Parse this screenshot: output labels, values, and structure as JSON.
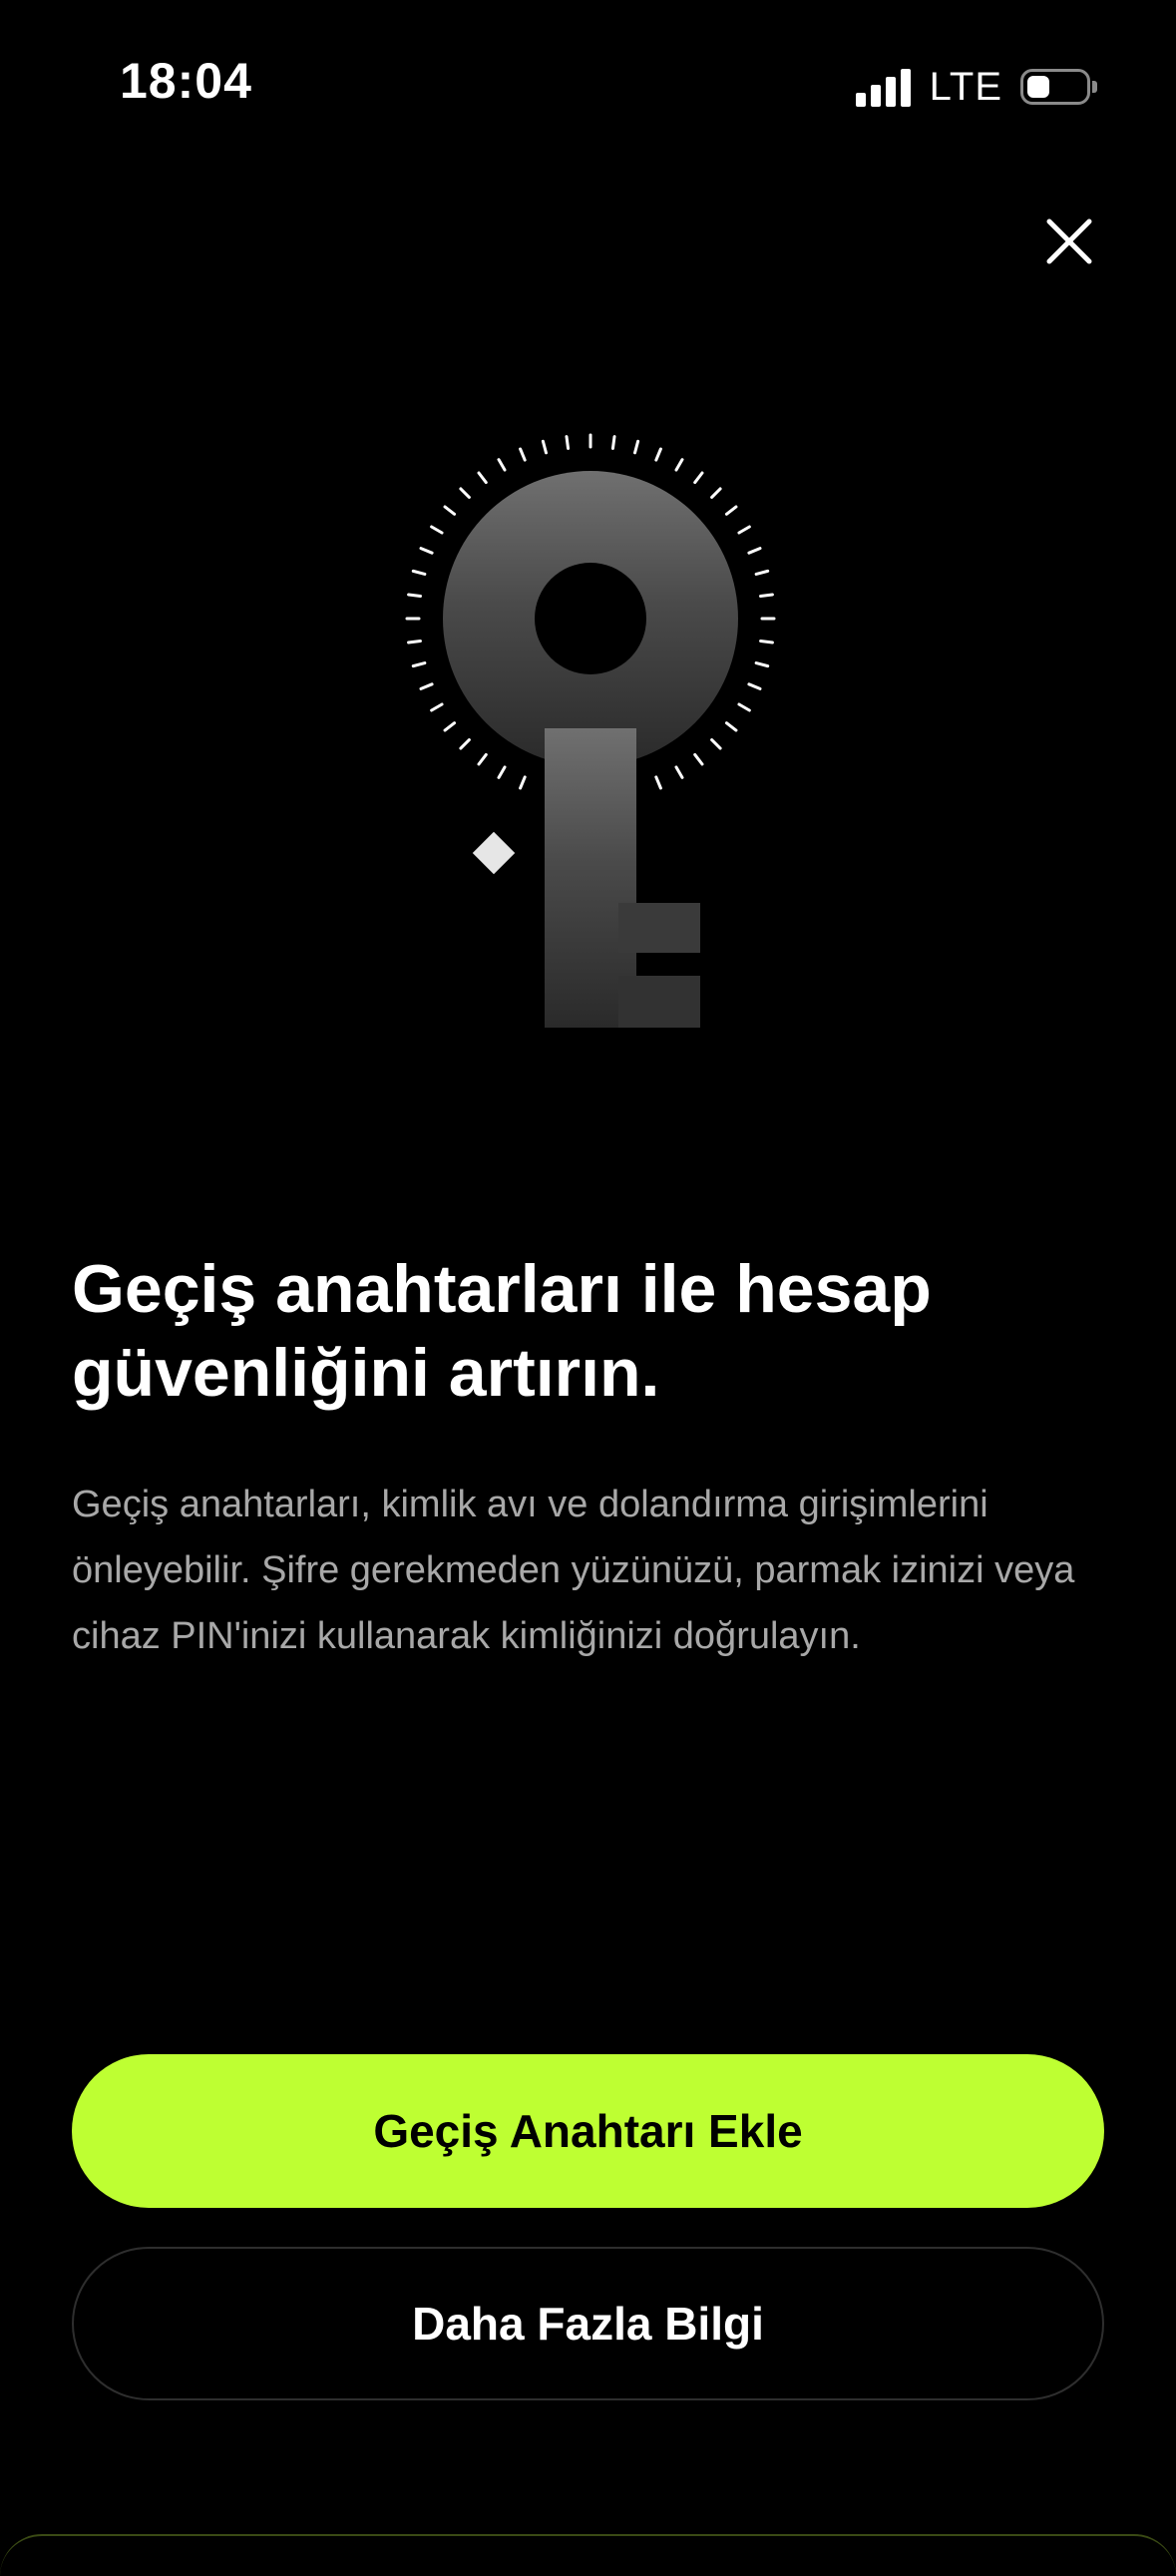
{
  "status_bar": {
    "time": "18:04",
    "network": "LTE",
    "icons": [
      "signal-icon",
      "battery-icon"
    ]
  },
  "header": {
    "close_icon": "close-icon"
  },
  "hero": {
    "icon": "passkey-key-icon"
  },
  "content": {
    "title": "Geçiş anahtarları ile hesap güvenliğini artırın.",
    "description": "Geçiş anahtarları, kimlik avı ve dolandırma girişimlerini önleyebilir. Şifre gerekmeden yüzünüzü, parmak izinizi veya cihaz PIN'inizi kullanarak kimliğinizi doğrulayın."
  },
  "actions": {
    "primary_label": "Geçiş Anahtarı Ekle",
    "secondary_label": "Daha Fazla Bilgi"
  },
  "colors": {
    "background": "#000000",
    "accent": "#beff32",
    "body_text": "#a8a8a8"
  }
}
